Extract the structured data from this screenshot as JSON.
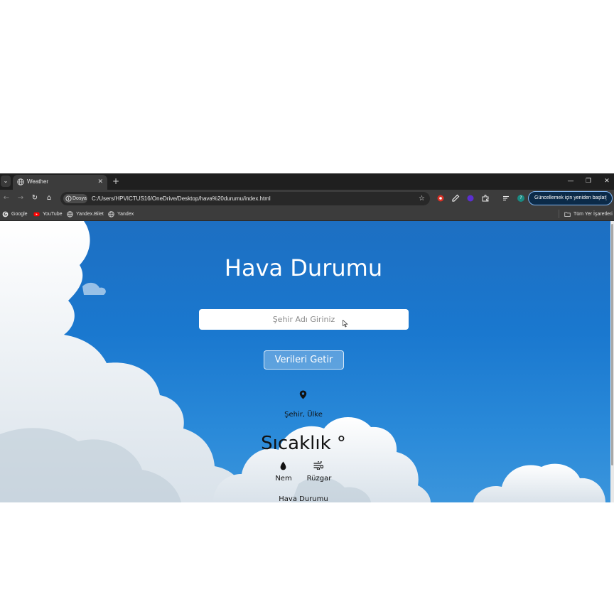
{
  "browser": {
    "tab": {
      "title": "Weather"
    },
    "address": {
      "security_chip": "Dosya",
      "url": "C:/Users/HPVICTUS16/OneDrive/Desktop/hava%20durumu/index.html"
    },
    "update_button": "Güncellemek için yeniden başlat",
    "profile_initial": "?",
    "bookmarks": [
      "Google",
      "YouTube",
      "Yandex.Bilet",
      "Yandex"
    ],
    "all_bookmarks": "Tüm Yer İşaretleri"
  },
  "page": {
    "title": "Hava Durumu",
    "search_placeholder": "Şehir Adı Giriniz",
    "fetch_button": "Verileri Getir",
    "location": "Şehir, Ülke",
    "temperature": "Sıcaklık °",
    "humidity_label": "Nem",
    "wind_label": "Rüzgar",
    "condition": "Hava Durumu"
  },
  "colors": {
    "sky": "#1a78cf",
    "toolbar": "#3c3c3c",
    "update_border": "#7fb4f0"
  },
  "icons": [
    "chevron-down-icon",
    "globe-icon",
    "close-icon",
    "plus-icon",
    "minimize-icon",
    "restore-icon",
    "back-icon",
    "forward-icon",
    "reload-icon",
    "home-icon",
    "info-icon",
    "star-icon",
    "extension-icon",
    "folder-icon",
    "location-pin-icon",
    "water-drop-icon",
    "wind-icon"
  ]
}
